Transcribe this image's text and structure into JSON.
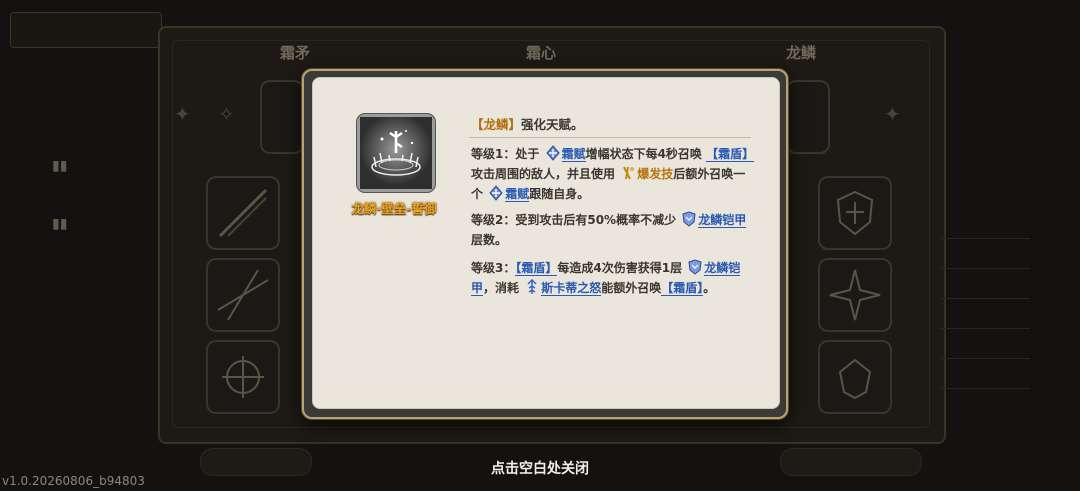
{
  "background": {
    "tabs": [
      "霜矛",
      "霜心",
      "龙鳞"
    ],
    "dimmed": true
  },
  "popup": {
    "skill": {
      "name": "龙鳞·壁垒-誓御",
      "icon": "frost-rune-aura-icon"
    },
    "title": {
      "tag": "【龙鳞】",
      "text": "强化天赋。"
    },
    "levels": [
      {
        "label": "等级1：",
        "parts": {
          "a": "处于",
          "b_link": "霜赋",
          "c": "增幅状态下每4秒召唤",
          "d_tag": "【霜盾】",
          "e": "攻击周围的敌人，并且使用",
          "f_link": "爆发技",
          "g": "后额外召唤一个",
          "h_link": "霜赋",
          "i": "跟随自身。"
        }
      },
      {
        "label": "等级2：",
        "parts": {
          "a": "受到攻击后有50%概率不减少",
          "b_link": "龙鳞铠甲",
          "c": "层数。"
        }
      },
      {
        "label": "等级3：",
        "parts": {
          "a_tag": "【霜盾】",
          "b": "每造成4次伤害获得1层",
          "c_link": "龙鳞铠甲",
          "d": "，消耗",
          "e_link": "斯卡蒂之怒",
          "f": "能额外召唤",
          "g_tag": "【霜盾】",
          "h": "。"
        }
      }
    ]
  },
  "close_hint": "点击空白处关闭",
  "version": "v1.0.20260806_b94803",
  "colors": {
    "gold": "#e7a628",
    "link_blue": "#2a5ab3",
    "orange": "#b8760e",
    "panel": "#ebe6dc"
  }
}
